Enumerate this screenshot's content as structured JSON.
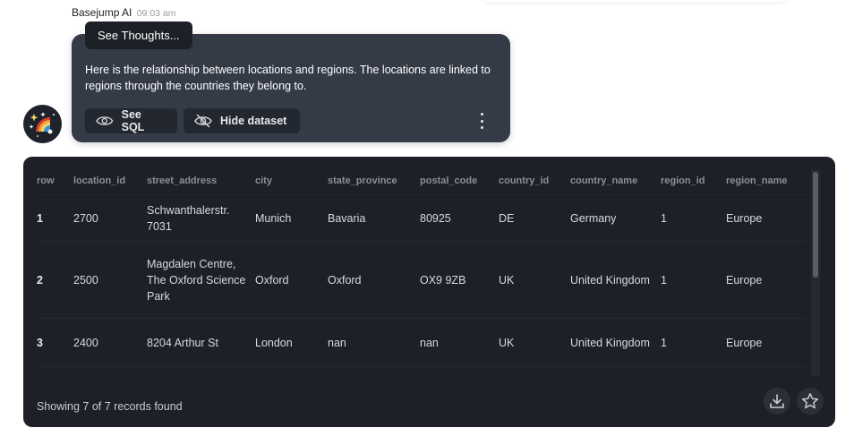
{
  "message": {
    "sender": "Basejump AI",
    "time": "09:03 am",
    "thoughts_label": "See Thoughts...",
    "text": "Here is the relationship between locations and regions. The locations are linked to regions through the countries they belong to.",
    "see_sql_label": "See SQL",
    "hide_dataset_label": "Hide dataset"
  },
  "table": {
    "columns": [
      "row",
      "location_id",
      "street_address",
      "city",
      "state_province",
      "postal_code",
      "country_id",
      "country_name",
      "region_id",
      "region_name"
    ],
    "rows": [
      [
        "1",
        "2700",
        "Schwanthalerstr. 7031",
        "Munich",
        "Bavaria",
        "80925",
        "DE",
        "Germany",
        "1",
        "Europe"
      ],
      [
        "2",
        "2500",
        "Magdalen Centre, The Oxford Science Park",
        "Oxford",
        "Oxford",
        "OX9 9ZB",
        "UK",
        "United Kingdom",
        "1",
        "Europe"
      ],
      [
        "3",
        "2400",
        "8204 Arthur St",
        "London",
        "nan",
        "nan",
        "UK",
        "United Kingdom",
        "1",
        "Europe"
      ]
    ]
  },
  "footer": {
    "records_text": "Showing 7 of 7 records found"
  },
  "icons": {
    "download": "download-icon",
    "star": "star-icon",
    "eye": "eye-icon",
    "eye_off": "eye-off-icon",
    "more": "more-vertical-icon"
  },
  "colors": {
    "bubble": "#343b47",
    "panel": "#1d2026",
    "button": "#222730"
  }
}
